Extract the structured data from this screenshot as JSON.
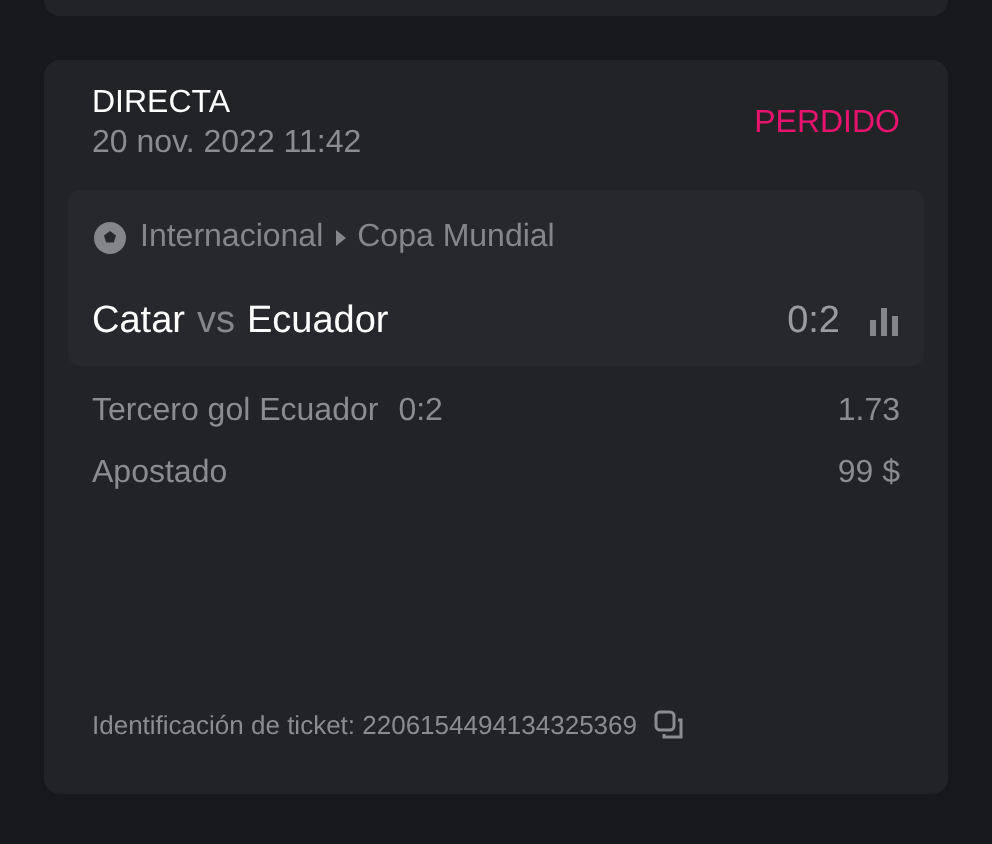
{
  "bet": {
    "type": "DIRECTA",
    "date": "20 nov. 2022 11:42",
    "status": {
      "kind": "lost",
      "label": "PERDIDO"
    },
    "match": {
      "sport": "Internacional",
      "league": "Copa Mundial",
      "home": "Catar",
      "vs": "vs",
      "away": "Ecuador",
      "score": "0:2"
    },
    "selection": {
      "market": "Tercero gol Ecuador",
      "score": "0:2",
      "odds": "1.73"
    },
    "stake": {
      "label": "Apostado",
      "value": "99 $"
    },
    "ticket": "Identificación de ticket: 2206154494134325369"
  }
}
